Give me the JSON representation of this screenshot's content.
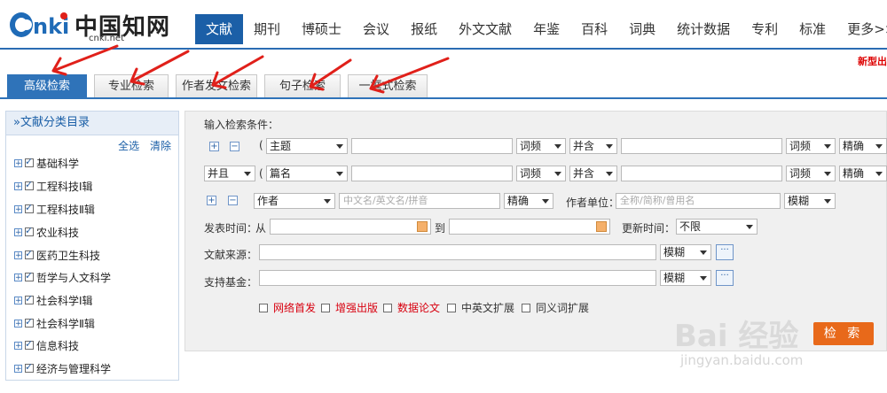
{
  "header": {
    "logo_text": "中国知网",
    "logo_url": "cnki.net",
    "nav": [
      "文献",
      "期刊",
      "博硕士",
      "会议",
      "报纸",
      "外文文献",
      "年鉴",
      "百科",
      "词典",
      "统计数据",
      "专利",
      "标准",
      "更多>>"
    ],
    "new_link": "新型出"
  },
  "tabs": [
    "高级检索",
    "专业检索",
    "作者发文检索",
    "句子检索",
    "一框式检索"
  ],
  "sidebar": {
    "title": "»文献分类目录",
    "select_all": "全选",
    "clear": "清除",
    "items": [
      "基础科学",
      "工程科技Ⅰ辑",
      "工程科技Ⅱ辑",
      "农业科技",
      "医药卫生科技",
      "哲学与人文科学",
      "社会科学Ⅰ辑",
      "社会科学Ⅱ辑",
      "信息科技",
      "经济与管理科学"
    ]
  },
  "form": {
    "title": "输入检索条件：",
    "row1": {
      "paren": "(",
      "field": "主题",
      "freq": "词频",
      "op": "并含",
      "freq2": "词频",
      "match": "精确"
    },
    "row2": {
      "logic": "并且",
      "paren": "(",
      "field": "篇名",
      "freq": "词频",
      "op": "并含",
      "freq2": "词频",
      "match": "精确"
    },
    "row3": {
      "field": "作者",
      "placeholder": "中文名/英文名/拼音",
      "match": "精确",
      "org_label": "作者单位：",
      "org_placeholder": "全称/简称/曾用名",
      "org_match": "模糊"
    },
    "date": {
      "label": "发表时间：",
      "from": "从",
      "to": "到",
      "update_label": "更新时间：",
      "update_value": "不限"
    },
    "source": {
      "label": "文献来源：",
      "match": "模糊",
      "btn": "···"
    },
    "fund": {
      "label": "支持基金：",
      "match": "模糊",
      "btn": "···"
    },
    "options": [
      "网络首发",
      "增强出版",
      "数据论文",
      "中英文扩展",
      "同义词扩展"
    ],
    "search_button": "检 索"
  },
  "watermark": {
    "text": "Bai 经验",
    "url": "jingyan.baidu.com"
  },
  "colors": {
    "brand": "#1b5fa7",
    "tab_active": "#2f73b9",
    "search_btn": "#e8691a",
    "annotation": "#e0201a"
  }
}
